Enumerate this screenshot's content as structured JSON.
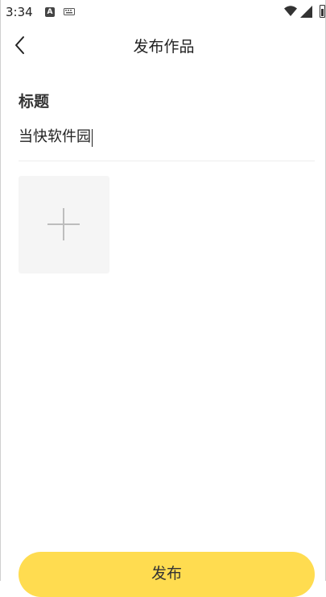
{
  "status_bar": {
    "time": "3:34",
    "app_icon_letter": "A",
    "icons": [
      "app-notification-icon",
      "keyboard-icon",
      "wifi-icon",
      "cell-signal-icon",
      "battery-icon"
    ]
  },
  "header": {
    "back_icon": "chevron-left-icon",
    "title": "发布作品"
  },
  "form": {
    "title_label": "标题",
    "title_value": "当快软件园",
    "add_image_icon": "plus-icon"
  },
  "footer": {
    "publish_label": "发布"
  },
  "colors": {
    "accent": "#ffdc50",
    "placeholder_bg": "#f5f5f5",
    "divider": "#eeeeee"
  }
}
